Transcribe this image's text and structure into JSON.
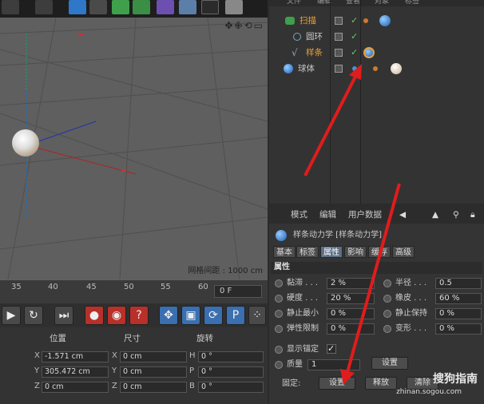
{
  "colors": {
    "accent_blue": "#5d6f87",
    "arrow_red": "#e01c1c",
    "spline_orange": "#e8a23a",
    "check_green": "#66cc66"
  },
  "viewport": {
    "grid_spacing": "网格间距 : 1000 cm",
    "nav_icons": "✥✙⟲▭"
  },
  "timeline": {
    "ticks": [
      "35",
      "40",
      "45",
      "50",
      "55",
      "60"
    ],
    "frame": "0 F"
  },
  "controls": {
    "icons": [
      "play-back-icon",
      "loop-icon",
      "skip-end-icon",
      "record-icon",
      "autokey-icon",
      "help-icon",
      "move-icon",
      "scale-icon",
      "rotate-icon",
      "param-icon",
      "dots-icon"
    ]
  },
  "coords": {
    "headers": {
      "position": "位置",
      "size": "尺寸",
      "rotation": "旋转"
    },
    "rows": [
      {
        "axis": "X",
        "pos": "-1.571 cm",
        "size_axis": "X",
        "size": "0 cm",
        "rot_axis": "H",
        "rot": "0 °"
      },
      {
        "axis": "Y",
        "pos": "305.472 cm",
        "size_axis": "Y",
        "size": "0 cm",
        "rot_axis": "P",
        "rot": "0 °"
      },
      {
        "axis": "Z",
        "pos": "0 cm",
        "size_axis": "Z",
        "size": "0 cm",
        "rot_axis": "B",
        "rot": "0 °"
      }
    ]
  },
  "objmgr": {
    "menu": [
      "文件",
      "编辑",
      "查看",
      "对象",
      "标签"
    ],
    "items": [
      {
        "name": "扫描",
        "color": "#e8a23a"
      },
      {
        "name": "圆环",
        "color": "#c8c8c8"
      },
      {
        "name": "样条",
        "color": "#e8a23a"
      },
      {
        "name": "球体",
        "color": "#c8c8c8"
      }
    ]
  },
  "attr": {
    "menu": [
      "模式",
      "编辑",
      "用户数据"
    ],
    "title": "样条动力学 [样条动力学]",
    "tabs": [
      "基本",
      "标签",
      "属性",
      "影响",
      "缓存",
      "高级"
    ],
    "section": "属性",
    "props_left": [
      {
        "label": "黏滞 . . .",
        "value": "2 %"
      },
      {
        "label": "硬度 . . .",
        "value": "20 %"
      },
      {
        "label": "静止最小",
        "value": "0 %"
      },
      {
        "label": "弹性限制",
        "value": "0 %"
      }
    ],
    "props_right": [
      {
        "label": "半径 . . .",
        "value": "0.5"
      },
      {
        "label": "橡皮 . . .",
        "value": "60 %"
      },
      {
        "label": "静止保持",
        "value": "0 %"
      },
      {
        "label": "变形 . . .",
        "value": "0 %"
      }
    ],
    "show_anchor": "显示锚定",
    "mass_label": "质量",
    "mass_value": "1",
    "set_btn": "设置",
    "fixed_label": "固定:",
    "set_btn2": "设置",
    "release_btn": "释放",
    "clear_btn": "清除"
  },
  "watermark": {
    "brand": "搜狗指南",
    "url": "zhinan.sogou.com"
  }
}
